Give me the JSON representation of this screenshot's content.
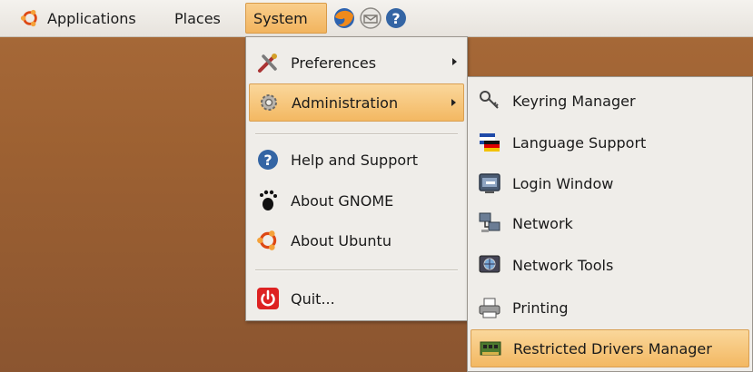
{
  "panel": {
    "applications_label": "Applications",
    "places_label": "Places",
    "system_label": "System",
    "launchers": [
      "firefox-icon",
      "mail-icon",
      "help-icon"
    ]
  },
  "system_menu": {
    "items": [
      {
        "label": "Preferences",
        "icon": "preferences-icon",
        "submenu": true
      },
      {
        "label": "Administration",
        "icon": "administration-icon",
        "submenu": true,
        "highlighted": true
      },
      {
        "label": "Help and Support",
        "icon": "help-icon"
      },
      {
        "label": "About GNOME",
        "icon": "gnome-foot-icon"
      },
      {
        "label": "About Ubuntu",
        "icon": "ubuntu-logo-icon"
      },
      {
        "label": "Quit...",
        "icon": "quit-icon"
      }
    ]
  },
  "administration_menu": {
    "items": [
      {
        "label": "Keyring Manager",
        "icon": "keyring-icon"
      },
      {
        "label": "Language Support",
        "icon": "language-flags-icon"
      },
      {
        "label": "Login Window",
        "icon": "login-window-icon"
      },
      {
        "label": "Network",
        "icon": "network-icon"
      },
      {
        "label": "Network Tools",
        "icon": "network-tools-icon"
      },
      {
        "label": "Printing",
        "icon": "printer-icon"
      },
      {
        "label": "Restricted Drivers Manager",
        "icon": "hardware-card-icon",
        "highlighted": true
      }
    ]
  },
  "colors": {
    "highlight": "#f3b862",
    "desktop": "#a06434",
    "menu_bg": "#efede9"
  }
}
